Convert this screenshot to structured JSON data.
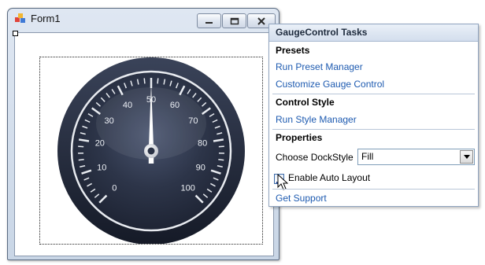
{
  "window": {
    "title": "Form1",
    "controls": {
      "minimize": "minimize",
      "maximize": "maximize",
      "close": "close"
    }
  },
  "gauge": {
    "scale_labels": [
      "0",
      "10",
      "20",
      "30",
      "40",
      "50",
      "60",
      "70",
      "80",
      "90",
      "100"
    ],
    "min": 0,
    "max": 100,
    "value": 50
  },
  "tasks": {
    "title": "GaugeControl Tasks",
    "presets": {
      "title": "Presets",
      "links": [
        "Run Preset Manager",
        "Customize Gauge Control"
      ]
    },
    "control_style": {
      "title": "Control Style",
      "links": [
        "Run Style Manager"
      ]
    },
    "properties": {
      "title": "Properties",
      "dock_label": "Choose DockStyle",
      "dock_value": "Fill",
      "auto_layout_label": "Enable Auto Layout",
      "auto_layout_checked": true
    },
    "support_link": "Get Support"
  },
  "colors": {
    "link": "#1d5ab0",
    "gauge_face": "#2a3347",
    "gauge_bezel": "#1f2637"
  },
  "icons": [
    "form-app-icon",
    "minimize-icon",
    "maximize-icon",
    "close-icon",
    "smart-tag-icon",
    "dropdown-arrow-icon",
    "checkmark-icon",
    "mouse-cursor-icon"
  ]
}
